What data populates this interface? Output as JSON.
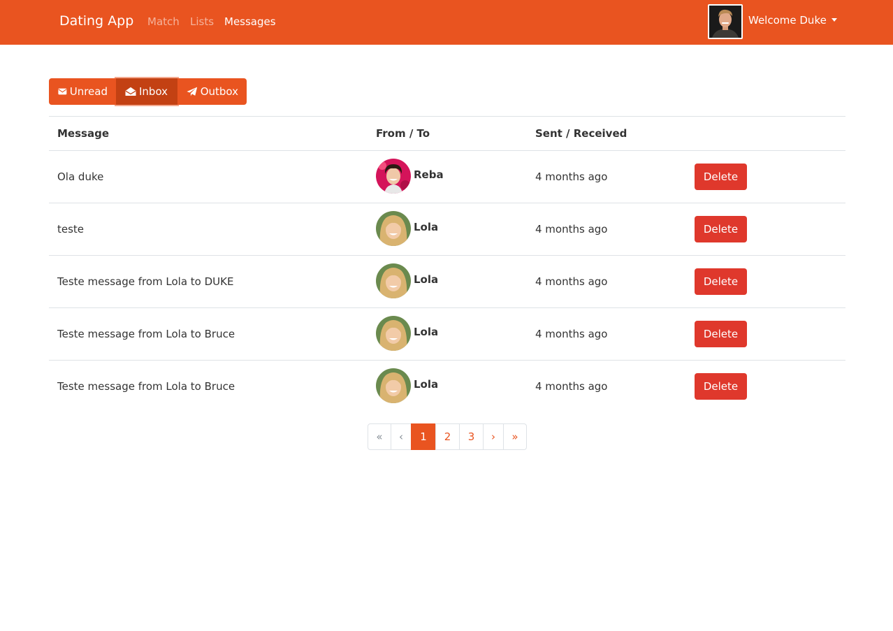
{
  "navbar": {
    "brand": "Dating App",
    "links": [
      "Match",
      "Lists",
      "Messages"
    ],
    "active_link": "Messages",
    "welcome": "Welcome Duke",
    "bg_color": "#e95420"
  },
  "tabs": {
    "items": [
      {
        "label": "Unread",
        "icon": "envelope-icon"
      },
      {
        "label": "Inbox",
        "icon": "envelope-open-icon"
      },
      {
        "label": "Outbox",
        "icon": "paper-plane-icon"
      }
    ],
    "active": "Inbox"
  },
  "table": {
    "headers": [
      "Message",
      "From / To",
      "Sent / Received",
      ""
    ],
    "rows": [
      {
        "message": "Ola duke",
        "from": "Reba",
        "sent": "4 months ago",
        "action": "Delete"
      },
      {
        "message": "teste",
        "from": "Lola",
        "sent": "4 months ago",
        "action": "Delete"
      },
      {
        "message": "Teste message from Lola to DUKE",
        "from": "Lola",
        "sent": "4 months ago",
        "action": "Delete"
      },
      {
        "message": "Teste message from Lola to Bruce",
        "from": "Lola",
        "sent": "4 months ago",
        "action": "Delete"
      },
      {
        "message": "Teste message from Lola to Bruce",
        "from": "Lola",
        "sent": "4 months ago",
        "action": "Delete"
      }
    ]
  },
  "pagination": {
    "first": "«",
    "prev": "‹",
    "pages": [
      "1",
      "2",
      "3"
    ],
    "current": "1",
    "next": "›",
    "last": "»"
  },
  "colors": {
    "primary": "#e95420",
    "primary_active": "#c34113",
    "danger": "#df382c",
    "border": "#dee2e6"
  }
}
